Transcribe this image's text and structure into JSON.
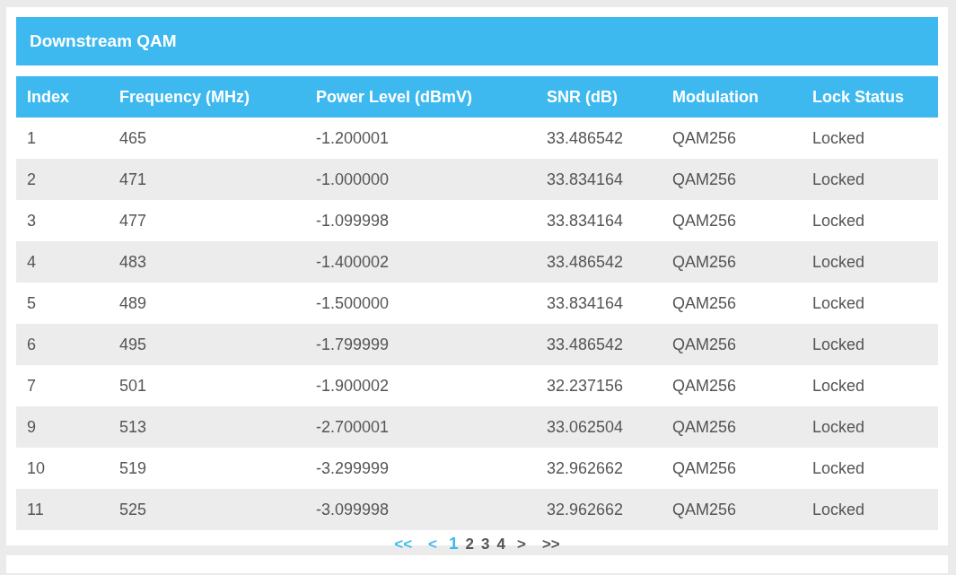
{
  "panel": {
    "title": "Downstream QAM"
  },
  "table": {
    "columns": [
      "Index",
      "Frequency (MHz)",
      "Power Level (dBmV)",
      "SNR (dB)",
      "Modulation",
      "Lock Status"
    ],
    "rows": [
      [
        "1",
        "465",
        "-1.200001",
        "33.486542",
        "QAM256",
        "Locked"
      ],
      [
        "2",
        "471",
        "-1.000000",
        "33.834164",
        "QAM256",
        "Locked"
      ],
      [
        "3",
        "477",
        "-1.099998",
        "33.834164",
        "QAM256",
        "Locked"
      ],
      [
        "4",
        "483",
        "-1.400002",
        "33.486542",
        "QAM256",
        "Locked"
      ],
      [
        "5",
        "489",
        "-1.500000",
        "33.834164",
        "QAM256",
        "Locked"
      ],
      [
        "6",
        "495",
        "-1.799999",
        "33.486542",
        "QAM256",
        "Locked"
      ],
      [
        "7",
        "501",
        "-1.900002",
        "32.237156",
        "QAM256",
        "Locked"
      ],
      [
        "9",
        "513",
        "-2.700001",
        "33.062504",
        "QAM256",
        "Locked"
      ],
      [
        "10",
        "519",
        "-3.299999",
        "32.962662",
        "QAM256",
        "Locked"
      ],
      [
        "11",
        "525",
        "-3.099998",
        "32.962662",
        "QAM256",
        "Locked"
      ]
    ]
  },
  "pagination": [
    {
      "label": "<<",
      "kind": "nav",
      "disabled": true,
      "selected": false
    },
    {
      "label": "<",
      "kind": "nav",
      "disabled": true,
      "selected": false
    },
    {
      "label": "1",
      "kind": "page",
      "disabled": false,
      "selected": true
    },
    {
      "label": "2",
      "kind": "page",
      "disabled": false,
      "selected": false
    },
    {
      "label": "3",
      "kind": "page",
      "disabled": false,
      "selected": false
    },
    {
      "label": "4",
      "kind": "page",
      "disabled": false,
      "selected": false
    },
    {
      "label": ">",
      "kind": "nav",
      "disabled": false,
      "selected": false
    },
    {
      "label": ">>",
      "kind": "nav",
      "disabled": false,
      "selected": false
    }
  ]
}
